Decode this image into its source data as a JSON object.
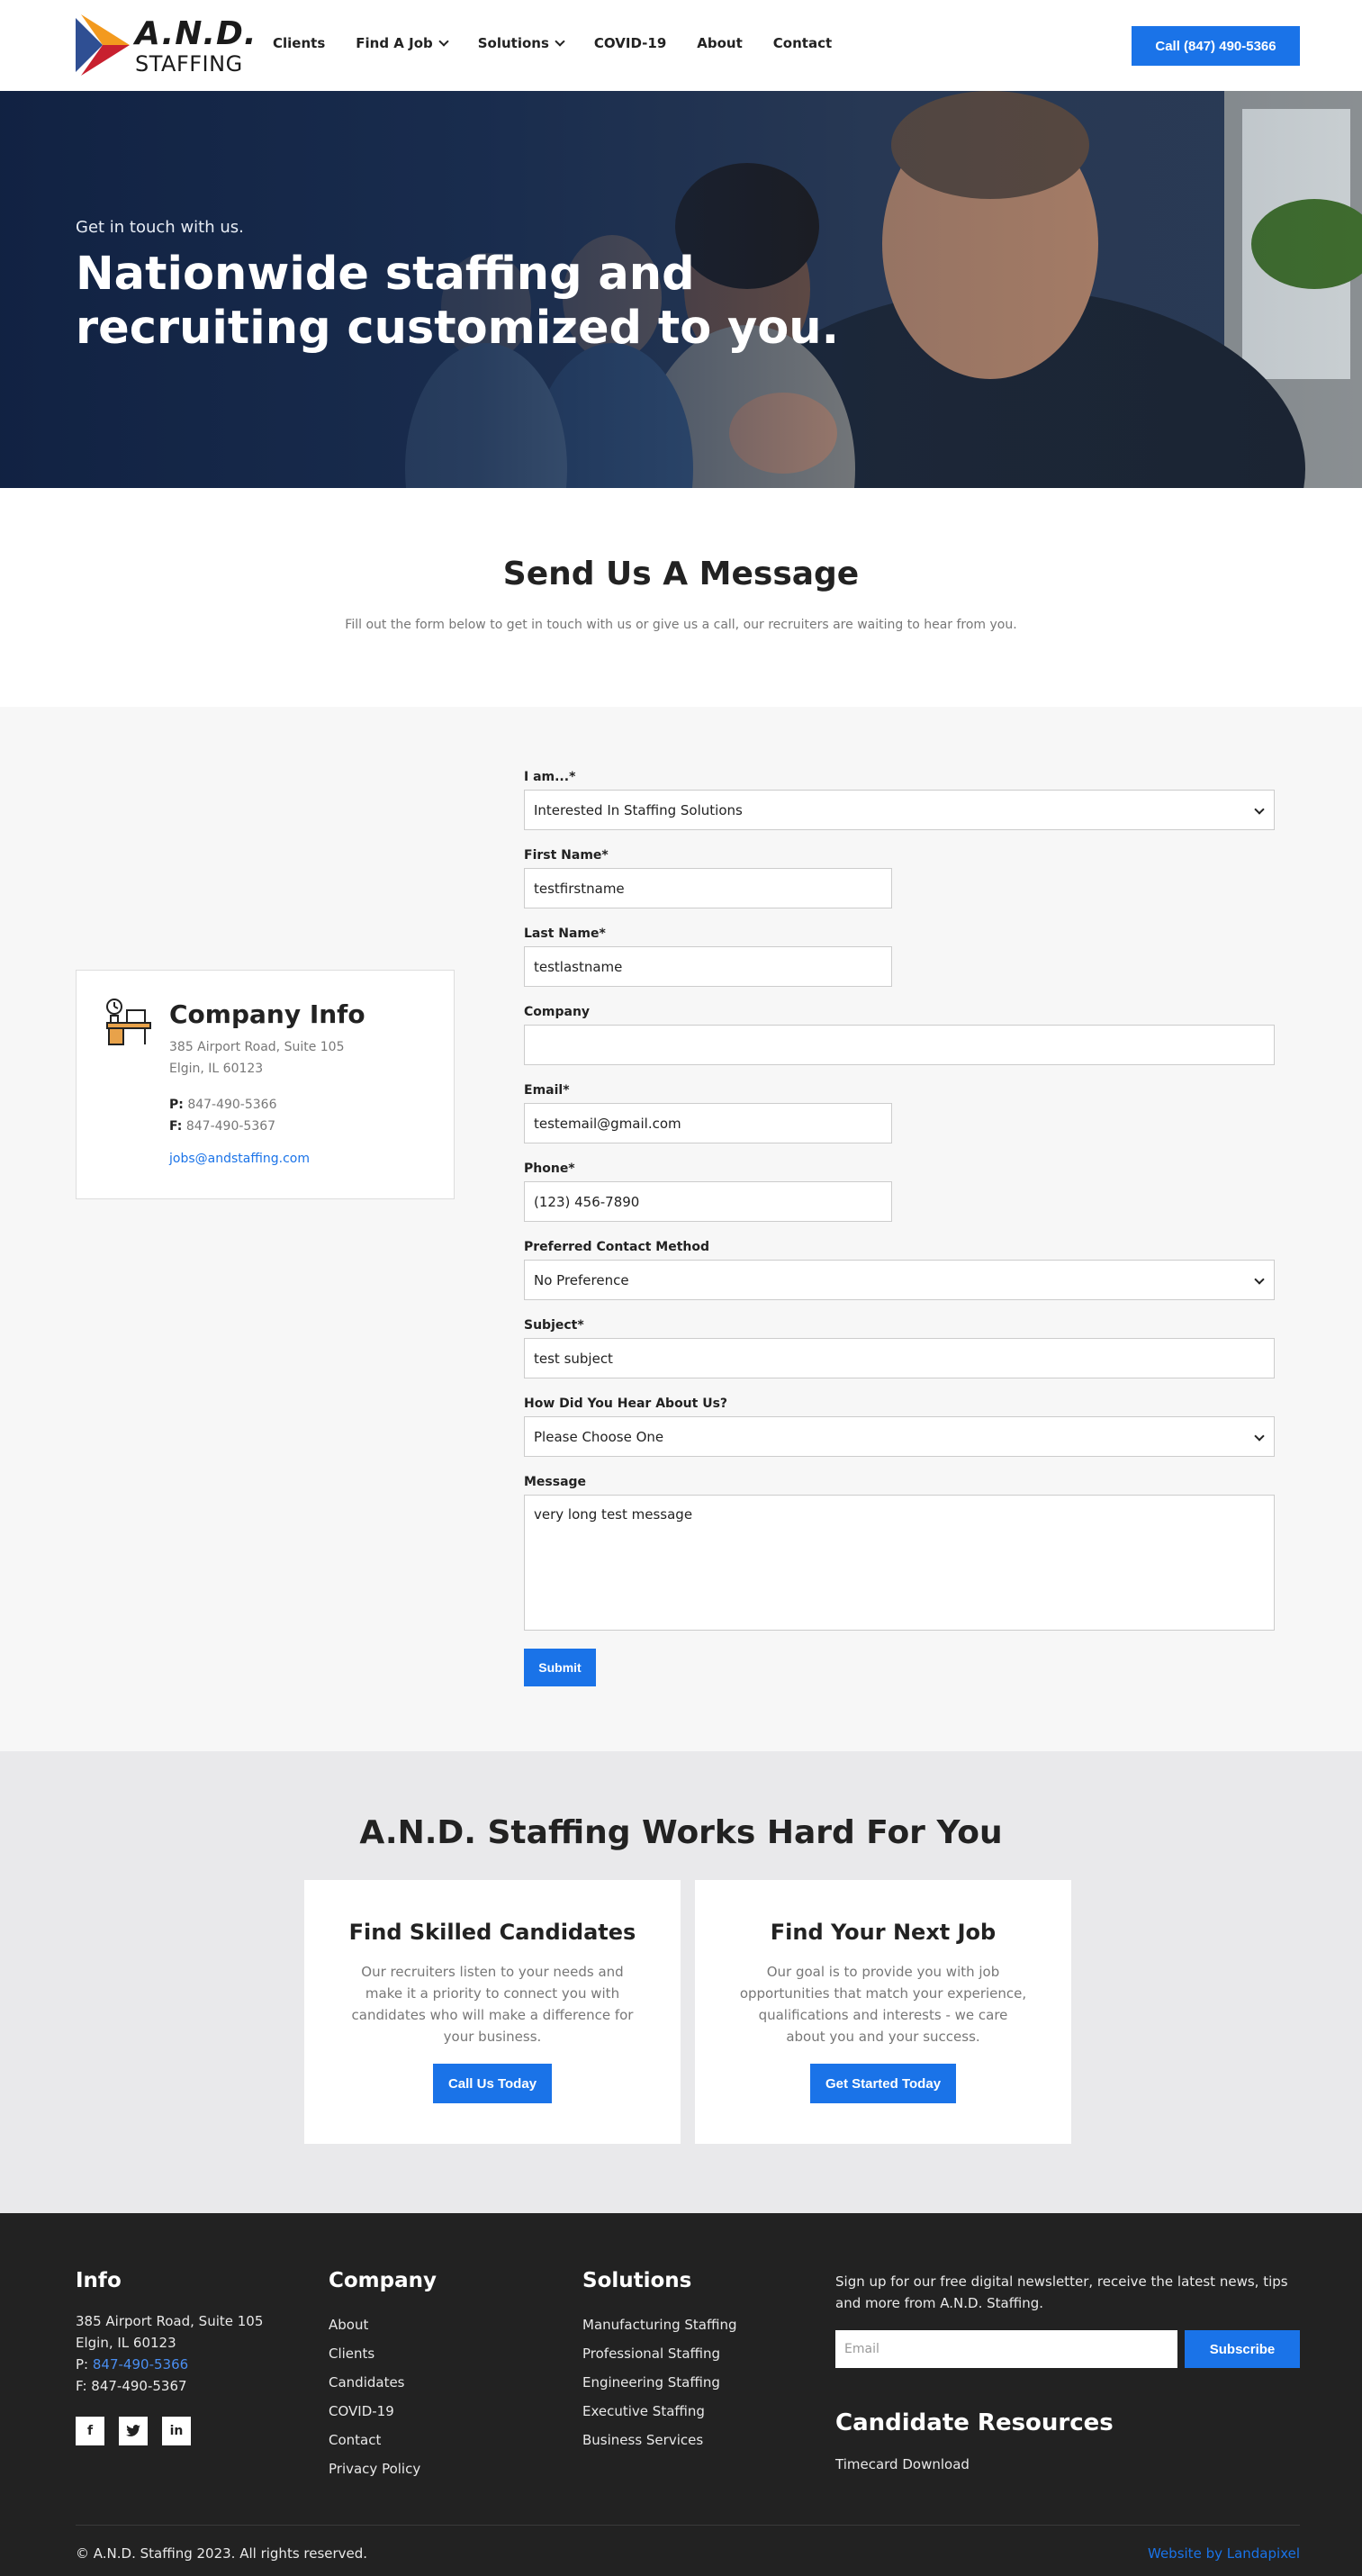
{
  "header": {
    "logo_main": "A.N.D.",
    "logo_sub": "STAFFING",
    "nav": [
      {
        "label": "Clients",
        "dropdown": false
      },
      {
        "label": "Find A Job",
        "dropdown": true
      },
      {
        "label": "Solutions",
        "dropdown": true
      },
      {
        "label": "COVID-19",
        "dropdown": false
      },
      {
        "label": "About",
        "dropdown": false
      },
      {
        "label": "Contact",
        "dropdown": false
      }
    ],
    "call_button": "Call (847) 490-5366"
  },
  "hero": {
    "kicker": "Get in touch with us.",
    "title": "Nationwide staffing and recruiting customized to you."
  },
  "intro": {
    "title": "Send Us A Message",
    "subtitle": "Fill out the form below to get in touch with us or give us a call, our recruiters are waiting to hear from you."
  },
  "company_info": {
    "title": "Company Info",
    "address1": "385 Airport Road, Suite 105",
    "address2": "Elgin, IL 60123",
    "phone_label": "P:",
    "phone": "847-490-5366",
    "fax_label": "F:",
    "fax": "847-490-5367",
    "email": "jobs@andstaffing.com"
  },
  "form": {
    "iam_label": "I am...*",
    "iam_value": "Interested In Staffing Solutions",
    "first_label": "First Name*",
    "first_value": "testfirstname",
    "last_label": "Last Name*",
    "last_value": "testlastname",
    "company_label": "Company",
    "company_value": "",
    "email_label": "Email*",
    "email_value": "testemail@gmail.com",
    "phone_label": "Phone*",
    "phone_value": "(123) 456-7890",
    "contact_label": "Preferred Contact Method",
    "contact_value": "No Preference",
    "subject_label": "Subject*",
    "subject_value": "test subject",
    "hear_label": "How Did You Hear About Us?",
    "hear_value": "Please Choose One",
    "message_label": "Message",
    "message_value": "very long test message",
    "submit": "Submit"
  },
  "works": {
    "title": "A.N.D. Staffing Works Hard For You",
    "cards": [
      {
        "title": "Find Skilled Candidates",
        "text": "Our recruiters listen to your needs and make it a priority to connect you with candidates who will make a difference for your business.",
        "button": "Call Us Today"
      },
      {
        "title": "Find Your Next Job",
        "text": "Our goal is to provide you with job opportunities that match your experience, qualifications and interests - we care about you and your success.",
        "button": "Get Started Today"
      }
    ]
  },
  "footer": {
    "info_title": "Info",
    "info_addr1": "385 Airport Road, Suite 105",
    "info_addr2": "Elgin, IL 60123",
    "info_phone_label": "P:",
    "info_phone": "847-490-5366",
    "info_fax": "F: 847-490-5367",
    "social": [
      "f",
      "t",
      "in"
    ],
    "company_title": "Company",
    "company_links": [
      "About",
      "Clients",
      "Candidates",
      "COVID-19",
      "Contact",
      "Privacy Policy"
    ],
    "solutions_title": "Solutions",
    "solutions_links": [
      "Manufacturing Staffing",
      "Professional Staffing",
      "Engineering Staffing",
      "Executive Staffing",
      "Business Services"
    ],
    "newsletter_text": "Sign up for our free digital newsletter, receive the latest news, tips and more from A.N.D. Staffing.",
    "email_placeholder": "Email",
    "subscribe": "Subscribe",
    "resources_title": "Candidate Resources",
    "resources_link": "Timecard Download",
    "copyright": "© A.N.D. Staffing 2023. All rights reserved.",
    "credit": "Website by Landapixel"
  },
  "colors": {
    "accent": "#1a73e8",
    "footer_bg": "#222222",
    "form_bg": "#f7f7f7",
    "works_bg": "#e9e9eb"
  }
}
